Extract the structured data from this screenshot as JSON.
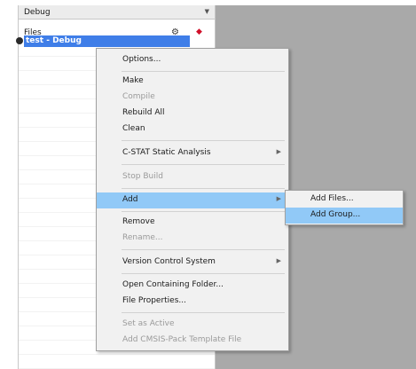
{
  "workspace": {
    "configuration": "Debug",
    "files_header": "Files",
    "project_name": "test - Debug"
  },
  "context_menu": {
    "items": [
      {
        "label": "Options...",
        "enabled": true
      },
      {
        "label": "Make",
        "enabled": true
      },
      {
        "label": "Compile",
        "enabled": false
      },
      {
        "label": "Rebuild All",
        "enabled": true
      },
      {
        "label": "Clean",
        "enabled": true
      },
      {
        "label": "C-STAT Static Analysis",
        "enabled": true
      },
      {
        "label": "Stop Build",
        "enabled": false
      },
      {
        "label": "Add",
        "enabled": true
      },
      {
        "label": "Remove",
        "enabled": true
      },
      {
        "label": "Rename...",
        "enabled": false
      },
      {
        "label": "Version Control System",
        "enabled": true
      },
      {
        "label": "Open Containing Folder...",
        "enabled": true
      },
      {
        "label": "File Properties...",
        "enabled": true
      },
      {
        "label": "Set as Active",
        "enabled": false
      },
      {
        "label": "Add CMSIS-Pack Template File",
        "enabled": false
      }
    ]
  },
  "add_submenu": {
    "items": [
      {
        "label": "Add Files..."
      },
      {
        "label": "Add Group..."
      }
    ]
  },
  "colors": {
    "selection": "#3f7ee8",
    "menu_highlight": "#91c9f7",
    "editor_background": "#a9a9a9"
  }
}
